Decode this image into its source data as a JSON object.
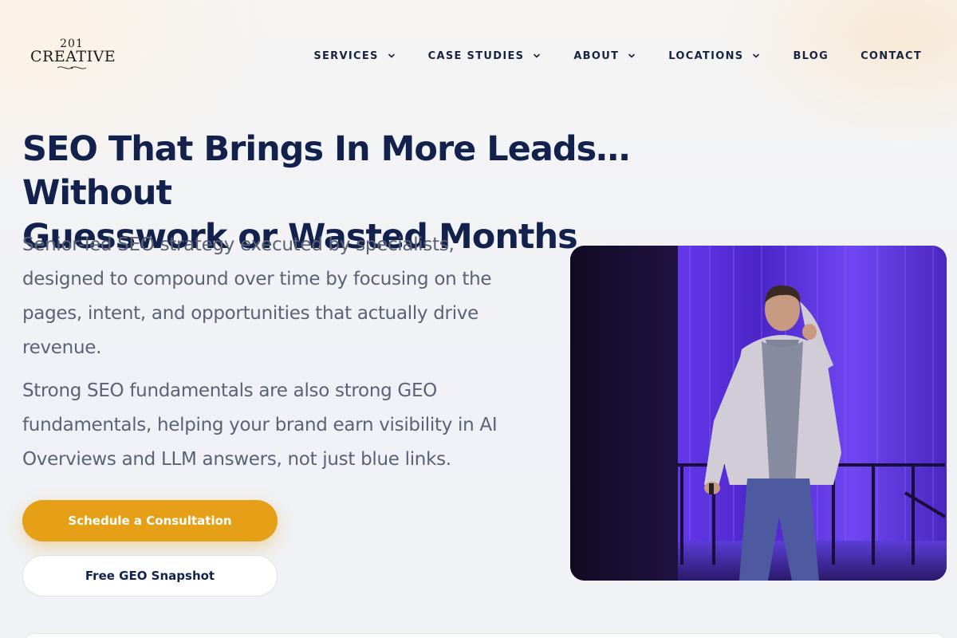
{
  "brand": {
    "logo_number": "201",
    "logo_word": "CREATIVE"
  },
  "nav": {
    "items": [
      {
        "label": "SERVICES",
        "has_dropdown": true
      },
      {
        "label": "CASE STUDIES",
        "has_dropdown": true
      },
      {
        "label": "ABOUT",
        "has_dropdown": true
      },
      {
        "label": "LOCATIONS",
        "has_dropdown": true
      },
      {
        "label": "BLOG",
        "has_dropdown": false
      },
      {
        "label": "CONTACT",
        "has_dropdown": false
      }
    ]
  },
  "hero": {
    "headline_line1": "SEO That Brings In More Leads… Without",
    "headline_line2": "Guesswork or Wasted Months",
    "paragraph1": "Senior-led SEO strategy executed by specialists, designed to compound over time by focusing on the pages, intent, and opportunities that actually drive revenue.",
    "paragraph2": "Strong SEO fundamentals are also strong GEO fundamentals, helping your brand earn visibility in AI Overviews and LLM answers, not just blue links.",
    "primary_cta": "Schedule a Consultation",
    "secondary_cta": "Free GEO Snapshot"
  },
  "colors": {
    "navy": "#13214d",
    "accent": "#e5a017",
    "body_text": "#5b6274",
    "stage_purple": "#5a2ee0"
  },
  "icons": {
    "dropdown": "chevron-down-icon"
  }
}
